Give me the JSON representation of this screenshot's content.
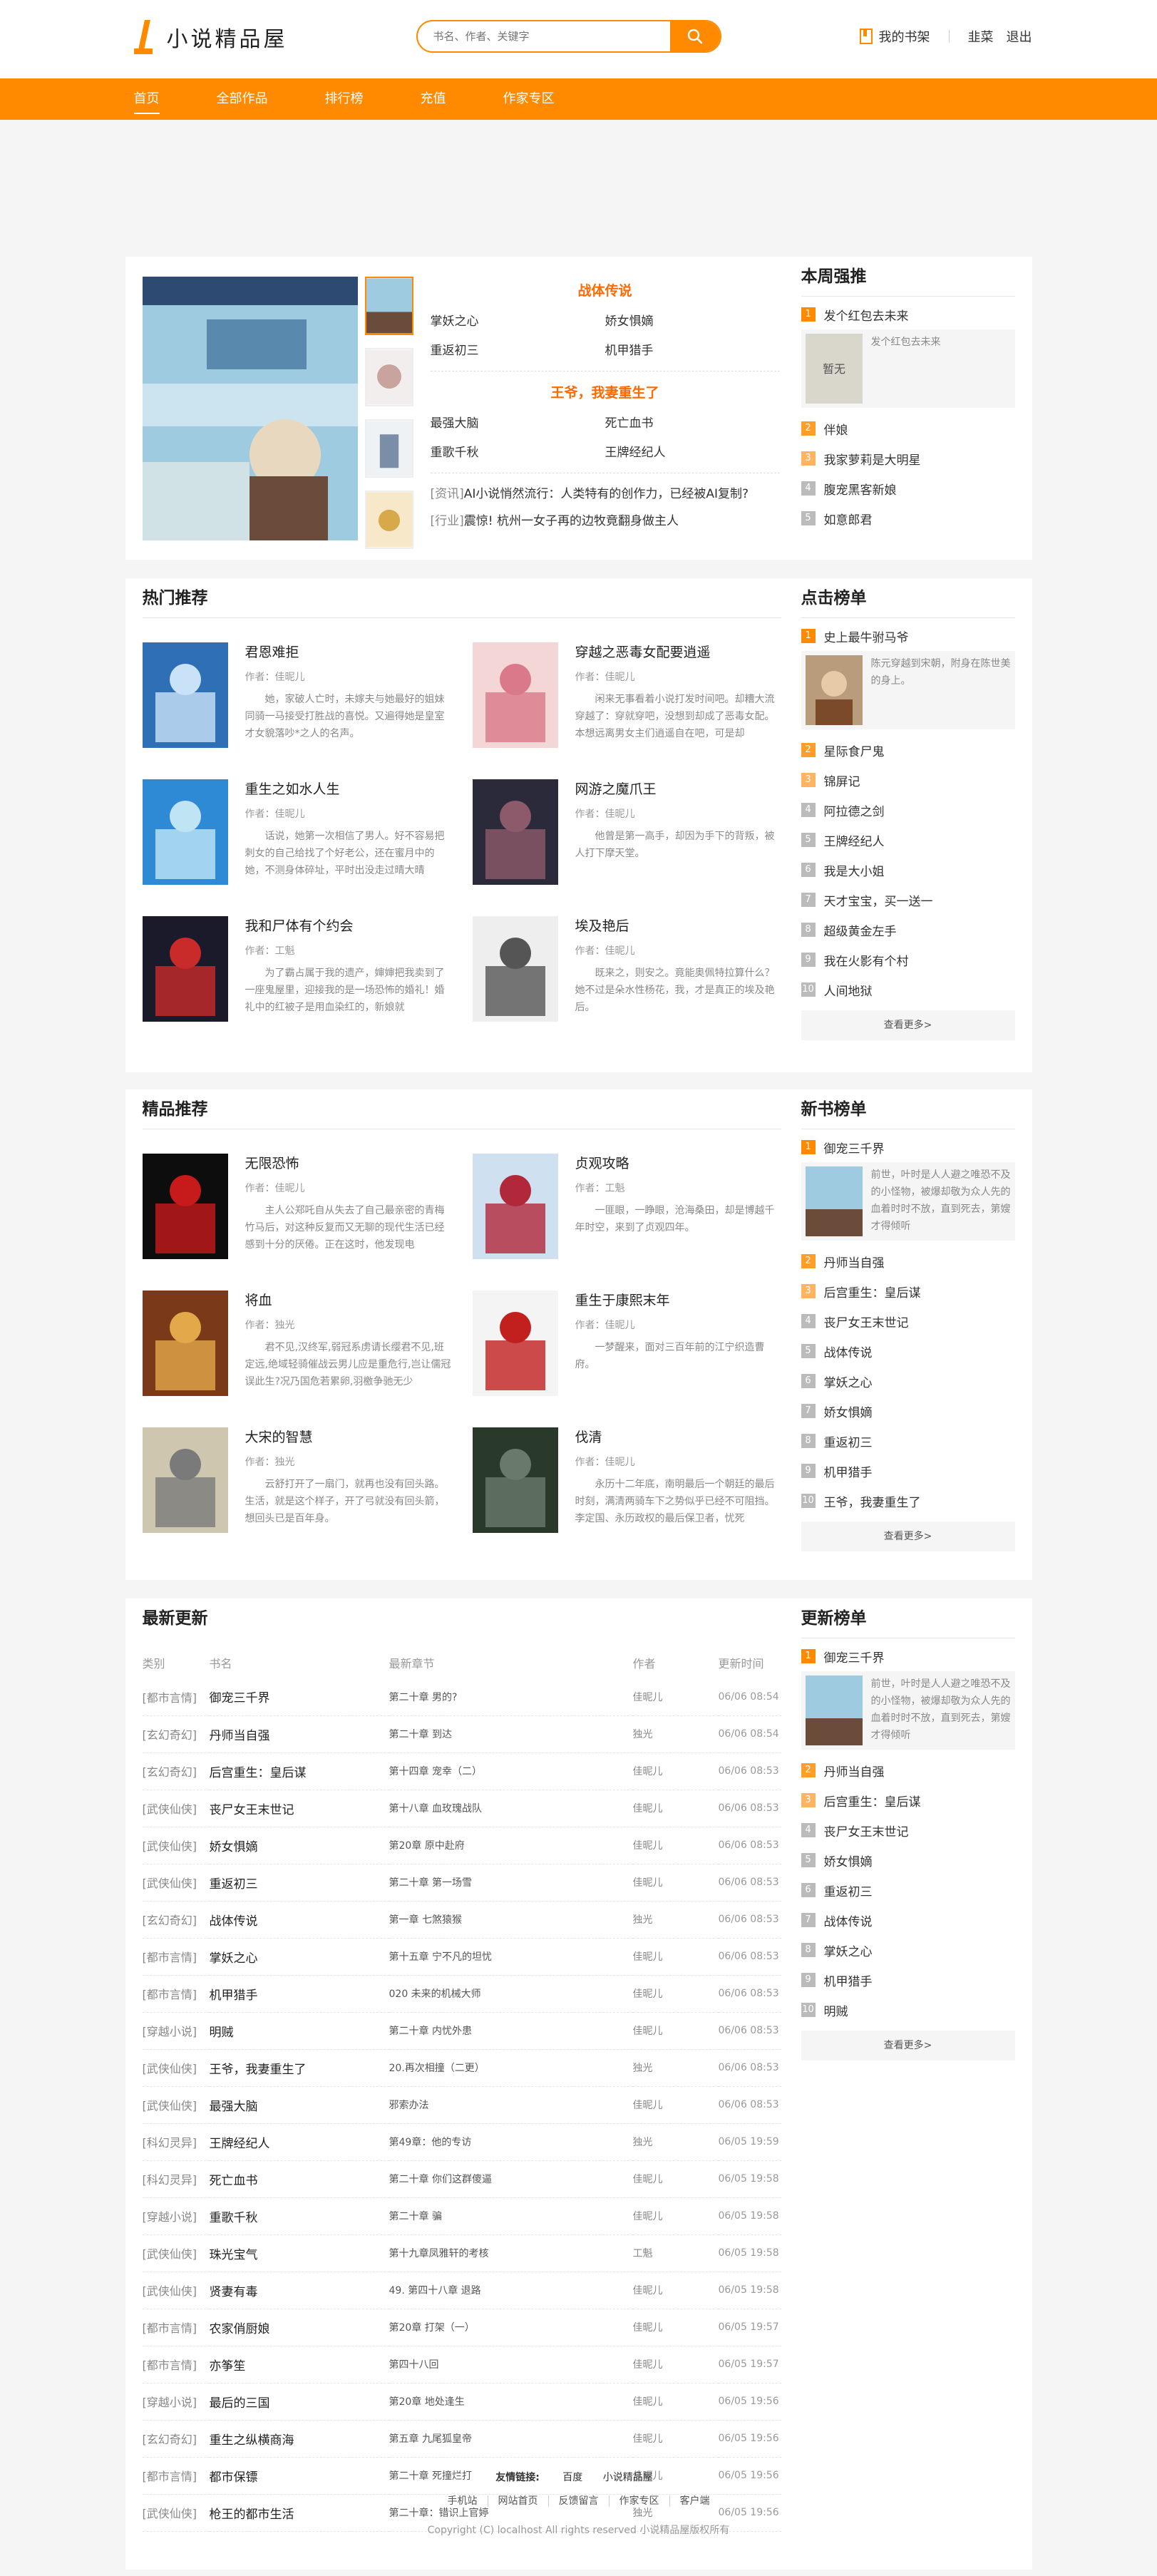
{
  "header": {
    "logo_text": "小说精品屋",
    "search_placeholder": "书名、作者、关键字",
    "bookshelf": "我的书架",
    "username": "韭菜",
    "logout": "退出"
  },
  "nav": [
    "首页",
    "全部作品",
    "排行榜",
    "充值",
    "作家专区"
  ],
  "accent_color": "#ff8a00",
  "featured": {
    "sections": [
      {
        "title": "战体传说",
        "books": [
          "掌妖之心",
          "娇女惧嫡",
          "重返初三",
          "机甲猎手"
        ]
      },
      {
        "title": "王爷，我妻重生了",
        "books": [
          "最强大脑",
          "死亡血书",
          "重歌千秋",
          "王牌经纪人"
        ]
      }
    ],
    "news": [
      {
        "tag": "[资讯]",
        "text": "AI小说悄然流行：人类特有的创作力，已经被AI复制?"
      },
      {
        "tag": "[行业]",
        "text": "震惊! 杭州一女子再的边牧竟翻身做主人"
      }
    ]
  },
  "weekly": {
    "title": "本周强推",
    "top": {
      "name": "发个红包去未来",
      "desc": "发个红包去未来"
    },
    "items": [
      "伴娘",
      "我家萝莉是大明星",
      "腹宠黑客新娘",
      "如意郎君"
    ]
  },
  "hot": {
    "title": "热门推荐",
    "books": [
      {
        "title": "君恩难拒",
        "author": "作者：佳昵儿",
        "desc": "她，家破人亡时，未嫁夫与她最好的姐妹同骑一马接受打胜战的喜悦。又遍得她是皇室才女貌落吵*之人的名声。"
      },
      {
        "title": "穿越之恶毒女配要逍遥",
        "author": "作者：佳昵儿",
        "desc": "闲来无事看着小说打发时间吧。却糟大流穿越了：穿就穿吧，没想到却成了恶毒女配。本想远离男女主们逍遥自在吧，可是却"
      },
      {
        "title": "重生之如水人生",
        "author": "作者：佳昵儿",
        "desc": "话说，她第一次相信了男人。好不容易把刺女的自己给找了个好老公，还在蜜月中的她，不测身体碎址，平时出没走过晴大晴"
      },
      {
        "title": "网游之魔爪王",
        "author": "作者：佳昵儿",
        "desc": "他曾是第一高手，却因为手下的背叛，被人打下摩天堂。"
      },
      {
        "title": "我和尸体有个约会",
        "author": "作者：工魁",
        "desc": "为了霸占属于我的遗产，婶婶把我卖到了一座鬼屋里，迎接我的是一场恐怖的婚礼！婚礼中的红被子是用血染红的，新娘就"
      },
      {
        "title": "埃及艳后",
        "author": "作者：佳昵儿",
        "desc": "既来之，则安之。竟能奥佩特拉算什么？她不过是朵水性杨花，我，才是真正的埃及艳后。"
      }
    ]
  },
  "click_rank": {
    "title": "点击榜单",
    "top": {
      "name": "史上最牛驸马爷",
      "desc": "陈元穿越到宋朝，附身在陈世美的身上。"
    },
    "items": [
      "星际食尸鬼",
      "锦屏记",
      "阿拉德之剑",
      "王牌经纪人",
      "我是大小姐",
      "天才宝宝，买一送一",
      "超级黄金左手",
      "我在火影有个村",
      "人间地狱"
    ],
    "more": "查看更多>"
  },
  "quality": {
    "title": "精品推荐",
    "books": [
      {
        "title": "无限恐怖",
        "author": "作者：佳昵儿",
        "desc": "主人公郑吒自从失去了自己最亲密的青梅竹马后，对这种反复而又无聊的现代生活已经感到十分的厌倦。正在这时，他发现电"
      },
      {
        "title": "贞观攻略",
        "author": "作者：工魁",
        "desc": "一匪眼，一睁眼，沧海桑田，却是博越千年时空，来到了贞观四年。"
      },
      {
        "title": "将血",
        "author": "作者：独光",
        "desc": "君不见,汉终军,弱冠系虏请长缨君不见,班定远,绝域轻骑催战云男儿应是重危行,岂让儒冠误此生?况乃国危若累卵,羽檄争驰无少"
      },
      {
        "title": "重生于康熙末年",
        "author": "作者：佳昵儿",
        "desc": "一梦醒来，面对三百年前的江宁织造曹府。"
      },
      {
        "title": "大宋的智慧",
        "author": "作者：独光",
        "desc": "云舒打开了一扇门，就再也没有回头路。生活，就是这个样子，开了弓就没有回头箭，想回头已是百年身。"
      },
      {
        "title": "伐清",
        "author": "作者：佳昵儿",
        "desc": "永历十二年底，南明最后一个朝廷的最后时刻，满清两骑车下之势似乎已经不可阻挡。李定国、永历政权的最后保卫者，忧死"
      }
    ]
  },
  "new_rank": {
    "title": "新书榜单",
    "top": {
      "name": "御宠三千界",
      "desc": "前世，叶时是人人避之唯恐不及的小怪物，被爆却敬为众人先的血着时时不放，直到死去，第嫂才得倾听"
    },
    "items": [
      "丹师当自强",
      "后宫重生：皇后谋",
      "丧尸女王末世记",
      "战体传说",
      "掌妖之心",
      "娇女惧嫡",
      "重返初三",
      "机甲猎手",
      "王爷，我妻重生了"
    ],
    "more": "查看更多>"
  },
  "latest": {
    "title": "最新更新",
    "headers": [
      "类别",
      "书名",
      "最新章节",
      "作者",
      "更新时间"
    ],
    "rows": [
      [
        "[都市言情]",
        "御宠三千界",
        "第二十章 男的?",
        "佳昵儿",
        "06/06 08:54"
      ],
      [
        "[玄幻奇幻]",
        "丹师当自强",
        "第二十章 到达",
        "独光",
        "06/06 08:54"
      ],
      [
        "[玄幻奇幻]",
        "后宫重生：皇后谋",
        "第十四章 宠幸（二）",
        "佳昵儿",
        "06/06 08:53"
      ],
      [
        "[武侠仙侠]",
        "丧尸女王末世记",
        "第十八章 血玫瑰战队",
        "佳昵儿",
        "06/06 08:53"
      ],
      [
        "[武侠仙侠]",
        "娇女惧嫡",
        "第20章 原中赴府",
        "佳昵儿",
        "06/06 08:53"
      ],
      [
        "[武侠仙侠]",
        "重返初三",
        "第二十章 第一场雪",
        "佳昵儿",
        "06/06 08:53"
      ],
      [
        "[玄幻奇幻]",
        "战体传说",
        "第一章 七煞猿猴",
        "独光",
        "06/06 08:53"
      ],
      [
        "[都市言情]",
        "掌妖之心",
        "第十五章 宁不凡的坦忧",
        "佳昵儿",
        "06/06 08:53"
      ],
      [
        "[都市言情]",
        "机甲猎手",
        "020 未来的机械大师",
        "佳昵儿",
        "06/06 08:53"
      ],
      [
        "[穿越小说]",
        "明贼",
        "第二十章 内忧外患",
        "佳昵儿",
        "06/06 08:53"
      ],
      [
        "[武侠仙侠]",
        "王爷，我妻重生了",
        "20.再次相撞（二更）",
        "独光",
        "06/06 08:53"
      ],
      [
        "[武侠仙侠]",
        "最强大脑",
        "邪索办法",
        "佳昵儿",
        "06/06 08:53"
      ],
      [
        "[科幻灵异]",
        "王牌经纪人",
        "第49章：他的专访",
        "独光",
        "06/05 19:59"
      ],
      [
        "[科幻灵异]",
        "死亡血书",
        "第二十章 你们这群傻逼",
        "佳昵儿",
        "06/05 19:58"
      ],
      [
        "[穿越小说]",
        "重歌千秋",
        "第二十章 骗",
        "佳昵儿",
        "06/05 19:58"
      ],
      [
        "[武侠仙侠]",
        "珠光宝气",
        "第十九章凤雅轩的考核",
        "工魁",
        "06/05 19:58"
      ],
      [
        "[武侠仙侠]",
        "贤妻有毒",
        "49. 第四十八章 退路",
        "佳昵儿",
        "06/05 19:58"
      ],
      [
        "[都市言情]",
        "农家俏厨娘",
        "第20章 打架（一）",
        "佳昵儿",
        "06/05 19:57"
      ],
      [
        "[都市言情]",
        "亦筝笙",
        "第四十八回",
        "佳昵儿",
        "06/05 19:57"
      ],
      [
        "[穿越小说]",
        "最后的三国",
        "第20章 地处逢生",
        "佳昵儿",
        "06/05 19:56"
      ],
      [
        "[玄幻奇幻]",
        "重生之纵横商海",
        "第五章 九尾狐皇帝",
        "佳昵儿",
        "06/05 19:56"
      ],
      [
        "[都市言情]",
        "都市保镖",
        "第二十章 死撞烂打",
        "佳昵儿",
        "06/05 19:56"
      ],
      [
        "[武侠仙侠]",
        "枪王的都市生活",
        "第二十章：错识上官婷",
        "独光",
        "06/05 19:56"
      ]
    ]
  },
  "update_rank": {
    "title": "更新榜单",
    "top": {
      "name": "御宠三千界",
      "desc": "前世，叶时是人人避之唯恐不及的小怪物，被爆却敬为众人先的血着时时不放，直到死去，第嫂才得倾听"
    },
    "items": [
      "丹师当自强",
      "后宫重生：皇后谋",
      "丧尸女王末世记",
      "娇女惧嫡",
      "重返初三",
      "战体传说",
      "掌妖之心",
      "机甲猎手",
      "明贼"
    ],
    "more": "查看更多>"
  },
  "footer": {
    "friend_label": "友情链接:",
    "friends": [
      "百度",
      "小说精品屋"
    ],
    "menu": [
      "手机站",
      "网站首页",
      "反馈留言",
      "作家专区",
      "客户端"
    ],
    "copyright": "Copyright (C) localhost All rights reserved 小说精品屋版权所有"
  }
}
